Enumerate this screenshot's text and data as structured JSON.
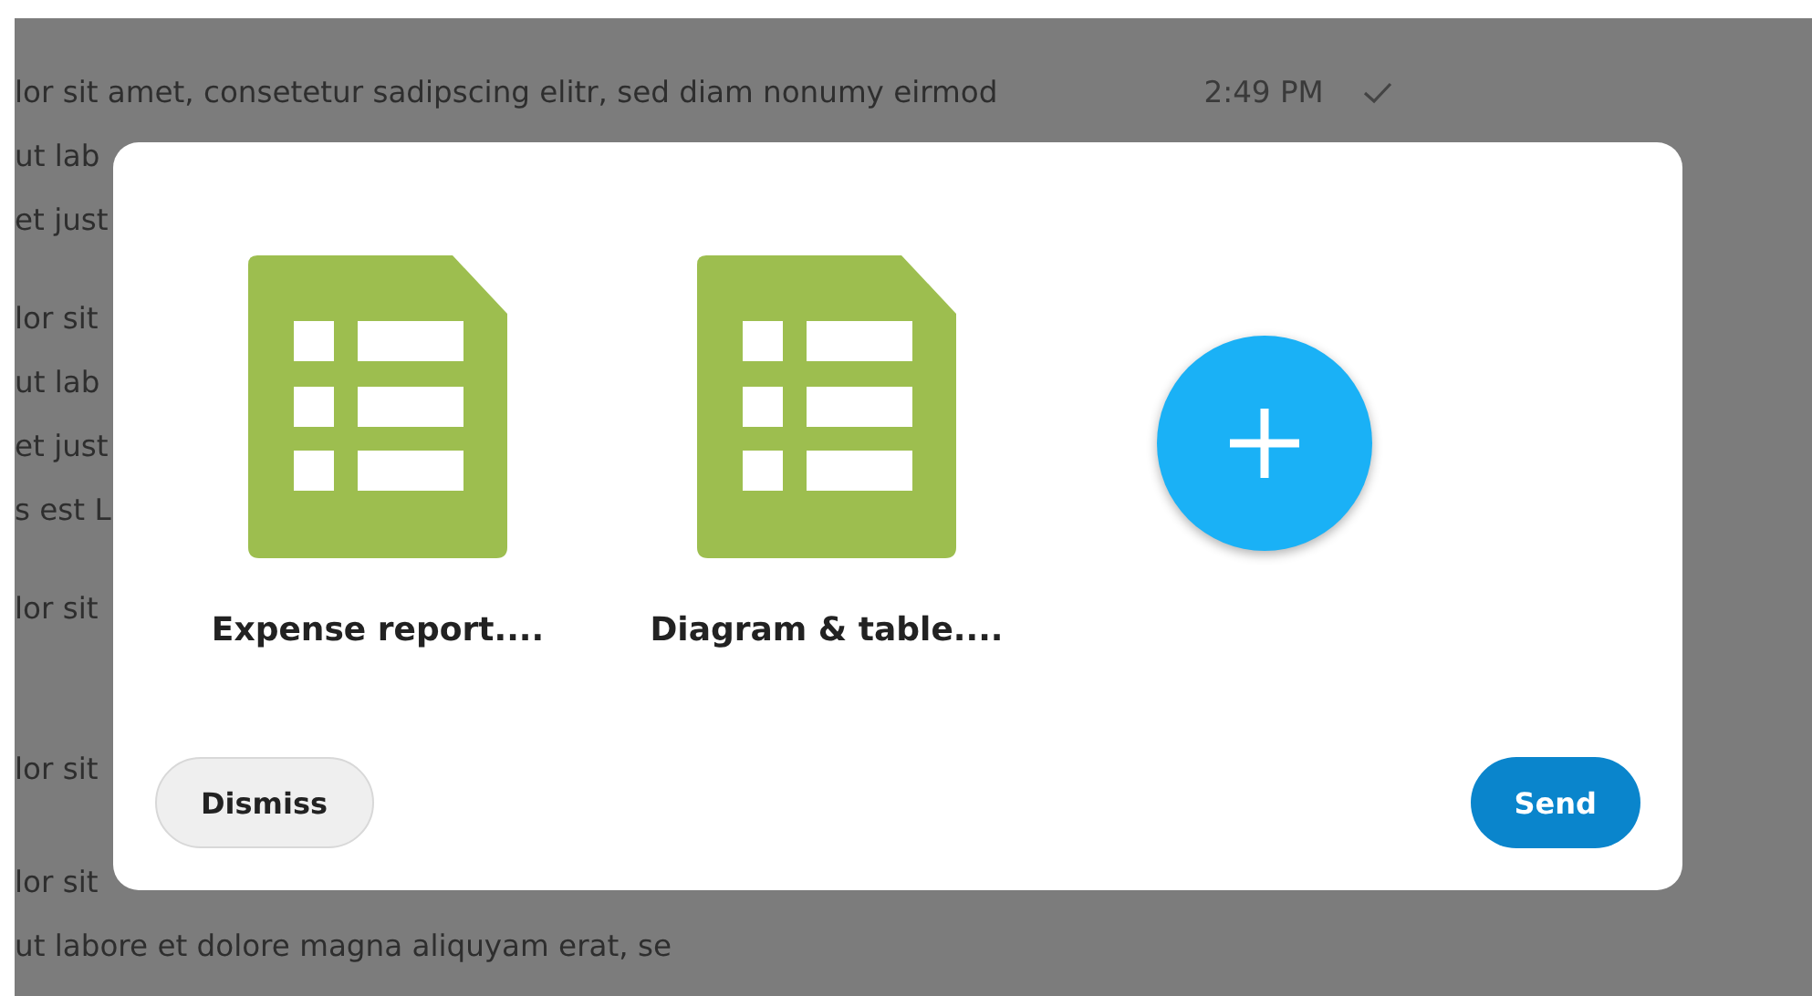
{
  "conversation": {
    "messages": [
      {
        "lines": [
          "lor sit amet, consetetur sadipscing elitr, sed diam nonumy eirmod",
          "ut lab",
          "et just"
        ],
        "time": "2:49 PM"
      },
      {
        "lines": [
          "lor sit",
          "ut lab",
          "et just",
          "s est L"
        ]
      },
      {
        "lines": [
          "lor sit"
        ]
      },
      {
        "lines": [
          "lor sit"
        ]
      },
      {
        "lines": [
          "lor sit",
          "ut labore et dolore magna aliquyam erat, se"
        ]
      }
    ]
  },
  "dialog": {
    "files": [
      {
        "name": "Expense report...."
      },
      {
        "name": "Diagram & table...."
      }
    ],
    "dismiss_button": "Dismiss",
    "send_button": "Send"
  }
}
